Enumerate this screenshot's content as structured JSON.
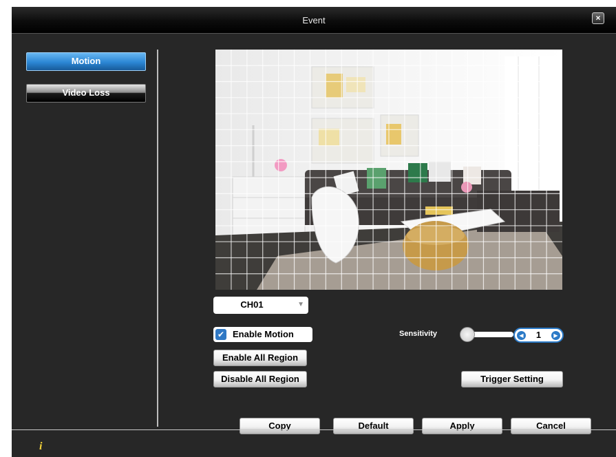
{
  "window": {
    "title": "Event",
    "close_icon": "close-icon"
  },
  "sidebar": {
    "items": [
      {
        "label": "Motion",
        "active": true
      },
      {
        "label": "Video Loss",
        "active": false
      }
    ]
  },
  "video": {
    "grid_cols": 22,
    "grid_rows": 15
  },
  "channel": {
    "selected": "CH01"
  },
  "motion": {
    "enable_label": "Enable Motion",
    "enabled": true,
    "enable_all_label": "Enable All Region",
    "disable_all_label": "Disable All Region"
  },
  "sensitivity": {
    "label": "Sensitivity",
    "value": "1"
  },
  "trigger": {
    "label": "Trigger Setting"
  },
  "footer": {
    "buttons": [
      "Copy",
      "Default",
      "Apply",
      "Cancel"
    ],
    "info_icon": "i"
  },
  "colors": {
    "accent": "#2b86d4",
    "background": "#272727",
    "info": "#f5d43a"
  }
}
